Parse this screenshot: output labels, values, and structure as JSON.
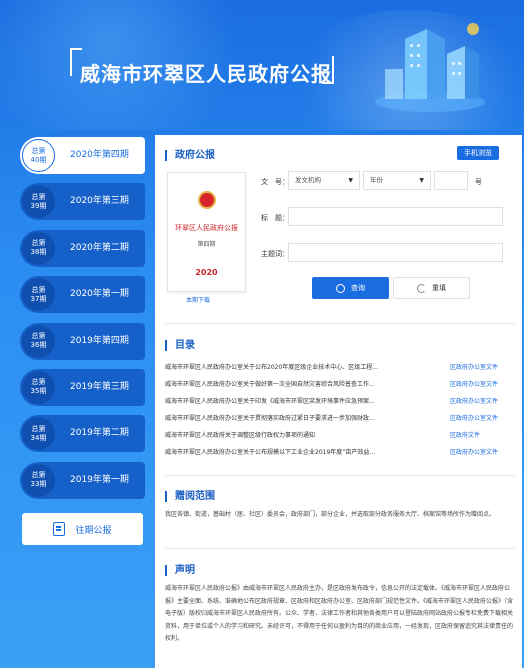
{
  "banner": {
    "title": "威海市环翠区人民政府公报"
  },
  "sidebar": {
    "issues": [
      {
        "badge_top": "总第",
        "badge_num": "40期",
        "label": "2020年第四期",
        "active": true
      },
      {
        "badge_top": "总第",
        "badge_num": "39期",
        "label": "2020年第三期"
      },
      {
        "badge_top": "总第",
        "badge_num": "38期",
        "label": "2020年第二期"
      },
      {
        "badge_top": "总第",
        "badge_num": "37期",
        "label": "2020年第一期"
      },
      {
        "badge_top": "总第",
        "badge_num": "36期",
        "label": "2019年第四期"
      },
      {
        "badge_top": "总第",
        "badge_num": "35期",
        "label": "2019年第三期"
      },
      {
        "badge_top": "总第",
        "badge_num": "34期",
        "label": "2019年第二期"
      },
      {
        "badge_top": "总第",
        "badge_num": "33期",
        "label": "2019年第一期"
      }
    ],
    "archive_label": "往期公报"
  },
  "gazette": {
    "section_title": "政府公报",
    "mobile_button": "手机浏览",
    "cover": {
      "title": "环翠区人民政府公报",
      "issue": "第四期",
      "year": "2020"
    },
    "download": "本期下载",
    "form": {
      "doc_no_label": "文　号：",
      "issuer_select": "发文机构",
      "year_select": "年份",
      "no_suffix": "号",
      "title_label": "标　题：",
      "keyword_label": "主题词："
    },
    "query_button": "查询",
    "reset_button": "重填"
  },
  "toc": {
    "title": "目录",
    "items": [
      {
        "title": "威海市环翠区人民政府办公室关于公布2020年度区级企业技术中心、区级工程...",
        "source": "区政府办公室文件"
      },
      {
        "title": "威海市环翠区人民政府办公室关于做好第一次全国自然灾害综合风险普查工作...",
        "source": "区政府办公室文件"
      },
      {
        "title": "威海市环翠区人民政府办公室关于印发《威海市环翠区突发环境事件应急预案...",
        "source": "区政府办公室文件"
      },
      {
        "title": "威海市环翠区人民政府办公室关于贯彻落实政府过紧日子要求进一步加强财政...",
        "source": "区政府办公室文件"
      },
      {
        "title": "威海市环翠区人民政府关于调整区级行政权力事项的通知",
        "source": "区政府文件"
      },
      {
        "title": "威海市环翠区人民政府办公室关于公布规模以下工业企业2019年度“亩产效益...",
        "source": "区政府办公室文件"
      }
    ]
  },
  "distribution": {
    "title": "赠阅范围",
    "text": "我区各镇、街道，基础村（居、社区）委员会，政府部门，部分企业，并选取部分政务服务大厅、档案馆等场所作为赠阅点。"
  },
  "statement": {
    "title": "声明",
    "text": "威海市环翠区人民政府公报》由威海市环翠区人民政府主办，是区政府发布政令，信息公开的法定载体。《威海市环翠区人民政府公报》主要全面、系统、准确地公布区政府规章、区政府和区政府办公室、区政府部门规范性文件。《威海市环翠区人民政府公报》（含电子版）版权归威海市环翠区人民政府所有。公众、学者、法律工作者和其他各类用户可以登陆政府网站政府公报专栏免费下载相关资料，用于单位或个人的学习和研究。未经许可，不得用于任何以盈利为目的的商业应用，一经发现，区政府保留追究其法律责任的权利。"
  }
}
